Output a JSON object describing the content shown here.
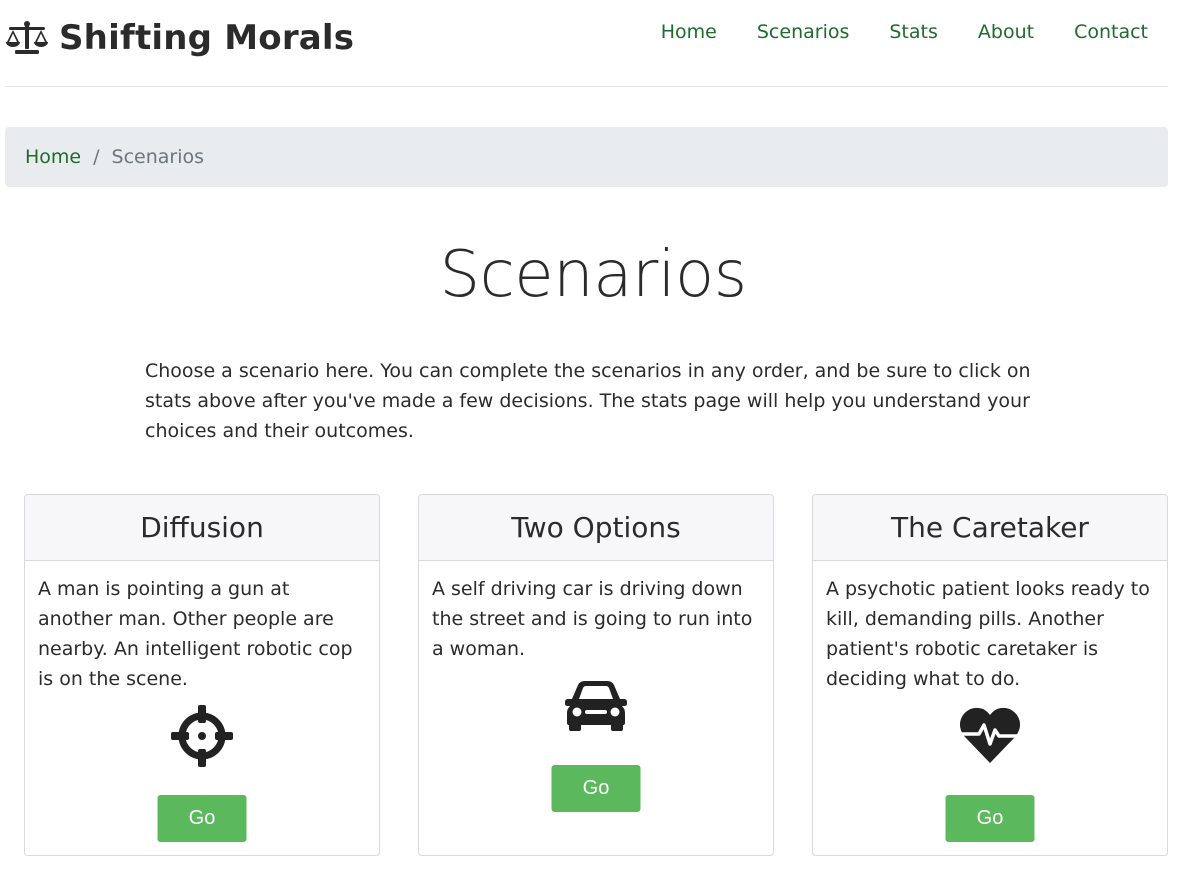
{
  "brand": {
    "name": "Shifting Morals",
    "icon": "balance-scale-icon"
  },
  "nav": [
    {
      "label": "Home"
    },
    {
      "label": "Scenarios"
    },
    {
      "label": "Stats"
    },
    {
      "label": "About"
    },
    {
      "label": "Contact"
    }
  ],
  "breadcrumb": {
    "home": "Home",
    "separator": "/",
    "current": "Scenarios"
  },
  "page": {
    "title": "Scenarios",
    "intro": "Choose a scenario here. You can complete the scenarios in any order, and be sure to click on stats above after you've made a few decisions. The stats page will help you understand your choices and their outcomes."
  },
  "cards": [
    {
      "title": "Diffusion",
      "text": "A man is pointing a gun at another man. Other people are nearby. An intelligent robotic cop is on the scene.",
      "icon": "crosshairs-icon",
      "button": "Go"
    },
    {
      "title": "Two Options",
      "text": "A self driving car is driving down the street and is going to run into a woman.",
      "icon": "car-icon",
      "button": "Go"
    },
    {
      "title": "The Caretaker",
      "text": "A psychotic patient looks ready to kill, demanding pills. Another patient's robotic caretaker is deciding what to do.",
      "icon": "heartbeat-icon",
      "button": "Go"
    }
  ],
  "colors": {
    "accent": "#1e6b2c",
    "button": "#5cb85c",
    "breadcrumb_bg": "#e9ecef"
  }
}
